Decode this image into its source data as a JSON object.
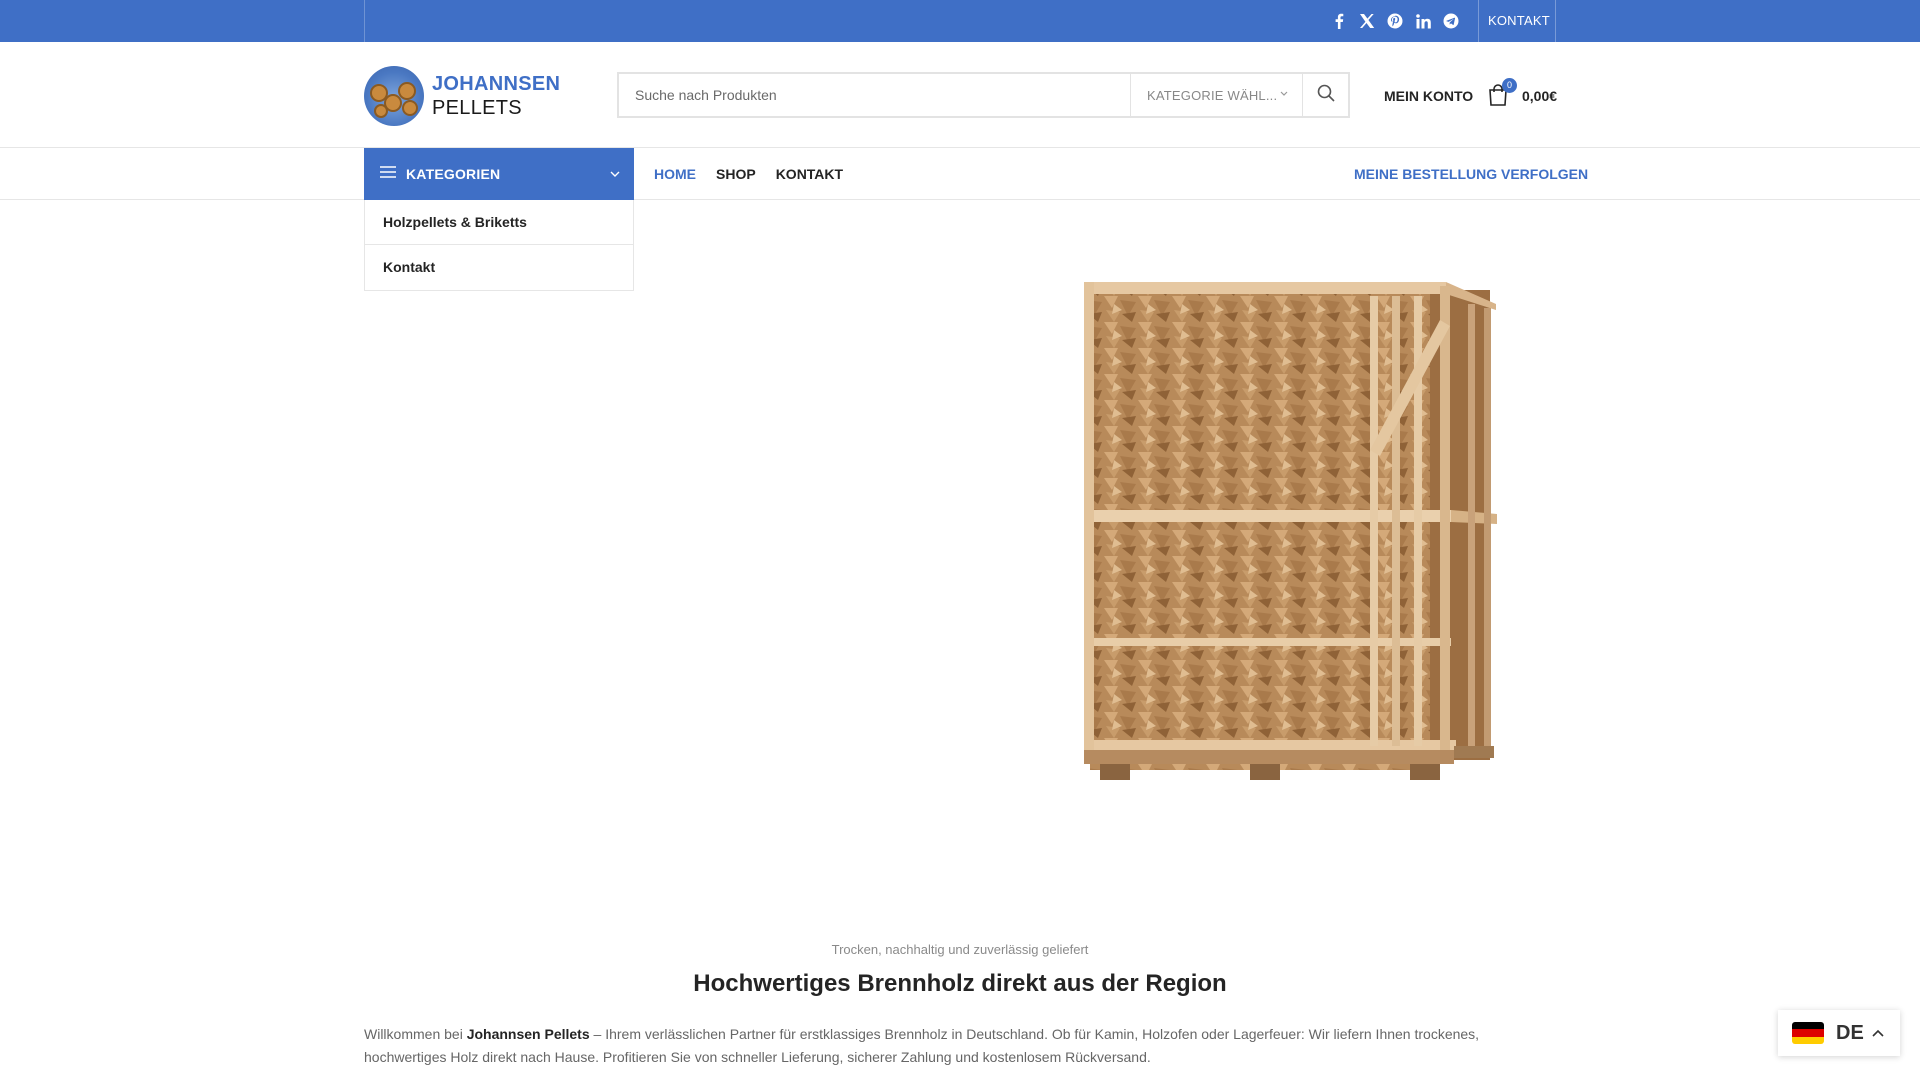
{
  "topbar": {
    "social_icons": [
      "facebook-icon",
      "x-icon",
      "pinterest-icon",
      "linkedin-icon",
      "telegram-icon"
    ],
    "contact_label": "KONTAKT"
  },
  "logo": {
    "line1": "JOHANNSEN",
    "line2": "PELLETS"
  },
  "search": {
    "placeholder": "Suche nach Produkten",
    "category_label": "KATEGORIE WÄHL..."
  },
  "header": {
    "account_label": "MEIN KONTO",
    "cart_count": "0",
    "cart_total": "0,00€"
  },
  "nav": {
    "categories_label": "KATEGORIEN",
    "menu": [
      {
        "label": "HOME",
        "active": true
      },
      {
        "label": "SHOP",
        "active": false
      },
      {
        "label": "KONTAKT",
        "active": false
      }
    ],
    "track_order_label": "MEINE BESTELLUNG VERFOLGEN"
  },
  "category_menu": {
    "items": [
      "Holzpellets & Briketts",
      "Kontakt"
    ]
  },
  "hero": {
    "subtitle": "Trocken, nachhaltig und zuverlässig geliefert",
    "title": "Hochwertiges Brennholz direkt aus der Region",
    "intro_prefix": "Willkommen bei ",
    "intro_brand": "Johannsen Pellets",
    "intro_text": " – Ihrem verlässlichen Partner für erstklassiges Brennholz in Deutschland. Ob für Kamin, Holzofen oder Lagerfeuer: Wir liefern Ihnen trockenes, hochwertiges Holz direkt nach Hause. Profitieren Sie von schneller Lieferung, sicherer Zahlung und kostenlosem Rückversand."
  },
  "language": {
    "code": "DE"
  },
  "colors": {
    "brand": "#3f6fc6",
    "text": "#242424",
    "muted": "#8a8a8a"
  }
}
